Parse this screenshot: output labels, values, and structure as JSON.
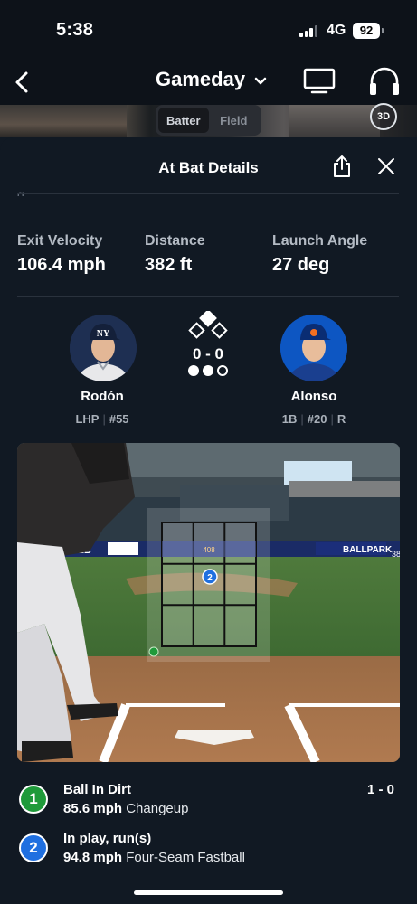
{
  "status_bar": {
    "time": "5:38",
    "network": "4G",
    "battery": "92"
  },
  "nav": {
    "title": "Gameday",
    "icons": [
      "back-chevron-icon",
      "chevron-down-icon",
      "tv-icon",
      "headphones-icon"
    ]
  },
  "view_toggle": {
    "options": [
      "Batter",
      "Field"
    ],
    "selected": "Batter",
    "three_d_label": "3D"
  },
  "sheet": {
    "title": "At Bat Details",
    "icons": [
      "share-icon",
      "close-icon"
    ]
  },
  "metrics": [
    {
      "label": "Exit Velocity",
      "value": "106.4 mph"
    },
    {
      "label": "Distance",
      "value": "382 ft"
    },
    {
      "label": "Launch Angle",
      "value": "27 deg"
    }
  ],
  "matchup": {
    "pitcher": {
      "name": "Rodón",
      "position": "LHP",
      "number": "#55"
    },
    "batter": {
      "name": "Alonso",
      "position": "1B",
      "number": "#20",
      "bats": "R"
    },
    "count": "0 - 0",
    "outs_filled": 2,
    "outs_total": 3
  },
  "field_view": {
    "ad_texts": [
      "MLB",
      "BALLPARK"
    ],
    "marker_labels": [
      "408",
      "38"
    ],
    "pitch_marker": "2"
  },
  "pitches": [
    {
      "number": "1",
      "result": "Ball In Dirt",
      "speed": "85.6 mph",
      "type": "Changeup",
      "count": "1 - 0",
      "color": "#1f9a3a"
    },
    {
      "number": "2",
      "result": "In play, run(s)",
      "speed": "94.8 mph",
      "type": "Four-Seam Fastball",
      "count": "",
      "color": "#1f6fe0"
    }
  ],
  "colors": {
    "background": "#111923",
    "ball_badge": "#1f9a3a",
    "in_play_badge": "#1f6fe0"
  }
}
